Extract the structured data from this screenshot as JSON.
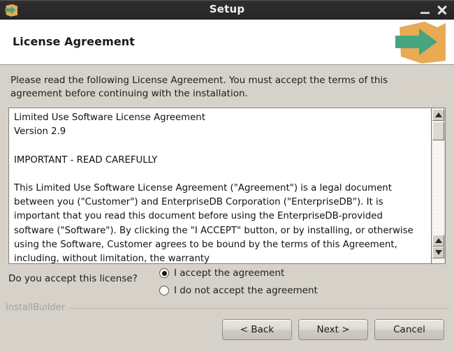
{
  "window": {
    "title": "Setup",
    "icon": "installer-box-arrow-icon",
    "minimize_label": "Minimize",
    "close_label": "Close"
  },
  "header": {
    "title": "License Agreement",
    "logo": "installer-box-arrow-logo"
  },
  "main": {
    "intro": "Please read the following License Agreement. You must accept the terms of this agreement before continuing with the installation.",
    "license_text": "Limited Use Software License Agreement\nVersion 2.9\n\nIMPORTANT - READ CAREFULLY\n\nThis Limited Use Software License Agreement (\"Agreement\") is a legal document between you (\"Customer\") and EnterpriseDB Corporation (\"EnterpriseDB\"). It is important that you read this document before using the EnterpriseDB-provided software (\"Software\"). By clicking the \"I ACCEPT\" button, or by installing, or otherwise using the Software, Customer agrees to be bound by the terms of this Agreement, including, without limitation, the warranty"
  },
  "accept": {
    "question": "Do you accept this license?",
    "options": [
      {
        "label": "I accept the agreement",
        "selected": true
      },
      {
        "label": "I do not accept the agreement",
        "selected": false
      }
    ]
  },
  "footer": {
    "brand": "InstallBuilder",
    "buttons": {
      "back": "< Back",
      "next": "Next >",
      "cancel": "Cancel"
    }
  },
  "colors": {
    "titlebar": "#2c2c2c",
    "body": "#d6d2ca",
    "header": "#ffffff",
    "logo_box": "#e8ab53",
    "logo_arrow": "#46a57f"
  }
}
